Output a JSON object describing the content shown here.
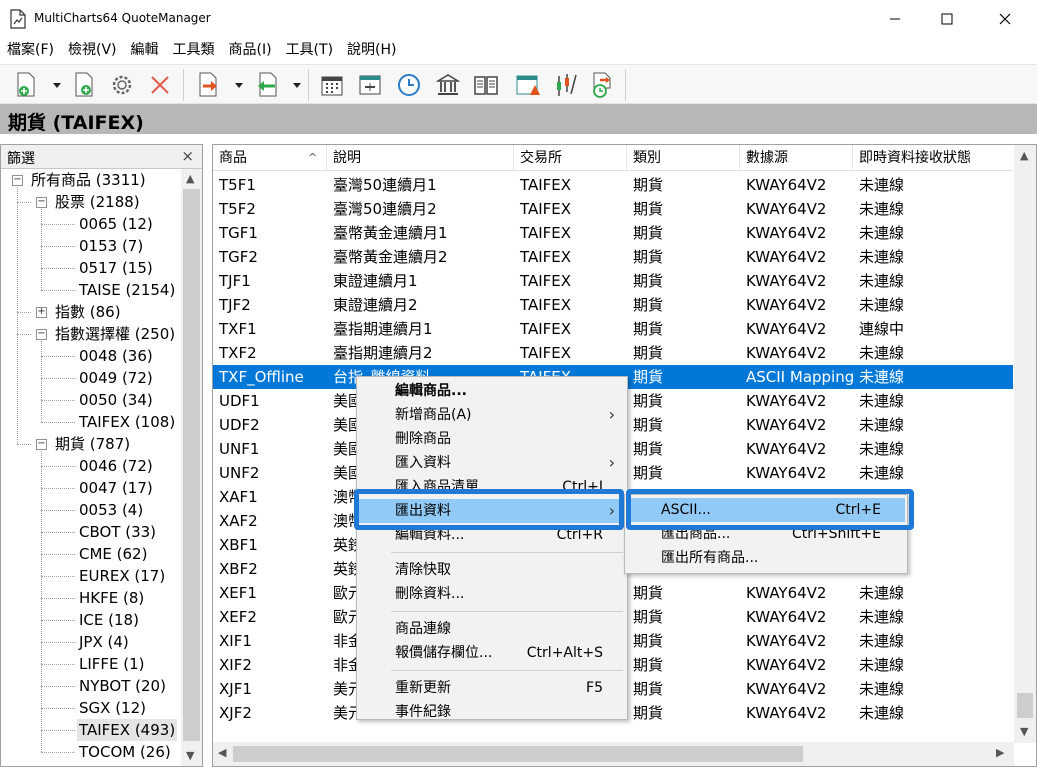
{
  "window": {
    "title": "MultiCharts64 QuoteManager"
  },
  "menubar": [
    "檔案(F)",
    "檢視(V)",
    "編輯",
    "工具類",
    "商品(I)",
    "工具(T)",
    "說明(H)"
  ],
  "toolbar": {
    "icons": [
      "new-symbol-icon",
      "add-symbol-icon",
      "settings-gear-icon",
      "delete-x-icon",
      "export-icon",
      "import-icon",
      "calendar-icon",
      "session-icon",
      "clock-icon",
      "exchange-building-icon",
      "book-icon",
      "calendar-warning-icon",
      "data-edit-icon",
      "scheduler-icon"
    ]
  },
  "header": {
    "title": "期貨 (TAIFEX)"
  },
  "filter": {
    "title": "篩選",
    "close": "×",
    "tree": [
      {
        "label": "所有商品 (3311)",
        "level": 0,
        "toggle": "−"
      },
      {
        "label": "股票 (2188)",
        "level": 1,
        "toggle": "−"
      },
      {
        "label": "0065 (12)",
        "level": 2
      },
      {
        "label": "0153 (7)",
        "level": 2
      },
      {
        "label": "0517 (15)",
        "level": 2
      },
      {
        "label": "TAISE (2154)",
        "level": 2
      },
      {
        "label": "指數 (86)",
        "level": 1,
        "toggle": "+"
      },
      {
        "label": "指數選擇權 (250)",
        "level": 1,
        "toggle": "−"
      },
      {
        "label": "0048 (36)",
        "level": 2
      },
      {
        "label": "0049 (72)",
        "level": 2
      },
      {
        "label": "0050 (34)",
        "level": 2
      },
      {
        "label": "TAIFEX (108)",
        "level": 2
      },
      {
        "label": "期貨 (787)",
        "level": 1,
        "toggle": "−"
      },
      {
        "label": "0046 (72)",
        "level": 2
      },
      {
        "label": "0047 (17)",
        "level": 2
      },
      {
        "label": "0053 (4)",
        "level": 2
      },
      {
        "label": "CBOT (33)",
        "level": 2
      },
      {
        "label": "CME (62)",
        "level": 2
      },
      {
        "label": "EUREX (17)",
        "level": 2
      },
      {
        "label": "HKFE (8)",
        "level": 2
      },
      {
        "label": "ICE (18)",
        "level": 2
      },
      {
        "label": "JPX (4)",
        "level": 2
      },
      {
        "label": "LIFFE (1)",
        "level": 2
      },
      {
        "label": "NYBOT (20)",
        "level": 2
      },
      {
        "label": "SGX (12)",
        "level": 2
      },
      {
        "label": "TAIFEX (493)",
        "level": 2,
        "selected": true
      },
      {
        "label": "TOCOM (26)",
        "level": 2
      }
    ]
  },
  "grid": {
    "columns": [
      "商品",
      "說明",
      "交易所",
      "類別",
      "數據源",
      "即時資料接收狀態"
    ],
    "sort_indicator": "^",
    "rows": [
      [
        "T5F1",
        "臺灣50連續月1",
        "TAIFEX",
        "期貨",
        "KWAY64V2",
        "未連線"
      ],
      [
        "T5F2",
        "臺灣50連續月2",
        "TAIFEX",
        "期貨",
        "KWAY64V2",
        "未連線"
      ],
      [
        "TGF1",
        "臺幣黃金連續月1",
        "TAIFEX",
        "期貨",
        "KWAY64V2",
        "未連線"
      ],
      [
        "TGF2",
        "臺幣黃金連續月2",
        "TAIFEX",
        "期貨",
        "KWAY64V2",
        "未連線"
      ],
      [
        "TJF1",
        "東證連續月1",
        "TAIFEX",
        "期貨",
        "KWAY64V2",
        "未連線"
      ],
      [
        "TJF2",
        "東證連續月2",
        "TAIFEX",
        "期貨",
        "KWAY64V2",
        "未連線"
      ],
      [
        "TXF1",
        "臺指期連續月1",
        "TAIFEX",
        "期貨",
        "KWAY64V2",
        "連線中"
      ],
      [
        "TXF2",
        "臺指期連續月2",
        "TAIFEX",
        "期貨",
        "KWAY64V2",
        "未連線"
      ],
      [
        "TXF_Offline",
        "台指_離線資料",
        "TAIFEX",
        "期貨",
        "ASCII Mapping",
        "未連線"
      ],
      [
        "UDF1",
        "美國",
        "",
        "期貨",
        "KWAY64V2",
        "未連線"
      ],
      [
        "UDF2",
        "美國",
        "",
        "期貨",
        "KWAY64V2",
        "未連線"
      ],
      [
        "UNF1",
        "美國",
        "",
        "期貨",
        "KWAY64V2",
        "未連線"
      ],
      [
        "UNF2",
        "美國",
        "",
        "期貨",
        "KWAY64V2",
        "未連線"
      ],
      [
        "XAF1",
        "澳幣",
        "",
        "",
        "",
        ""
      ],
      [
        "XAF2",
        "澳幣",
        "",
        "",
        "",
        ""
      ],
      [
        "XBF1",
        "英鎊",
        "",
        "",
        "",
        ""
      ],
      [
        "XBF2",
        "英鎊",
        "",
        "",
        "",
        ""
      ],
      [
        "XEF1",
        "歐元",
        "",
        "期貨",
        "KWAY64V2",
        "未連線"
      ],
      [
        "XEF2",
        "歐元",
        "",
        "期貨",
        "KWAY64V2",
        "未連線"
      ],
      [
        "XIF1",
        "非金",
        "",
        "期貨",
        "KWAY64V2",
        "未連線"
      ],
      [
        "XIF2",
        "非金",
        "",
        "期貨",
        "KWAY64V2",
        "未連線"
      ],
      [
        "XJF1",
        "美元",
        "",
        "期貨",
        "KWAY64V2",
        "未連線"
      ],
      [
        "XJF2",
        "美元",
        "",
        "期貨",
        "KWAY64V2",
        "未連線"
      ]
    ],
    "selected_row": 8
  },
  "context_menu": {
    "items": [
      {
        "label": "編輯商品...",
        "bold": true
      },
      {
        "label": "新增商品(A)",
        "submenu": true
      },
      {
        "label": "刪除商品"
      },
      {
        "label": "匯入資料",
        "submenu": true
      },
      {
        "label": "匯入商品清單...",
        "shortcut": "Ctrl+I"
      },
      {
        "label": "匯出資料",
        "submenu": true,
        "highlighted": true
      },
      {
        "label": "編輯資料...",
        "shortcut": "Ctrl+R"
      },
      {
        "separator": true
      },
      {
        "label": "清除快取"
      },
      {
        "label": "刪除資料..."
      },
      {
        "separator": true
      },
      {
        "label": "商品連線"
      },
      {
        "label": "報價儲存欄位...",
        "shortcut": "Ctrl+Alt+S"
      },
      {
        "separator": true
      },
      {
        "label": "重新更新",
        "shortcut": "F5"
      },
      {
        "label": "事件紀錄"
      }
    ]
  },
  "submenu": {
    "items": [
      {
        "label": "ASCII...",
        "shortcut": "Ctrl+E",
        "highlighted": true
      },
      {
        "label": "匯出商品...",
        "shortcut": "Ctrl+Shift+E"
      },
      {
        "label": "匯出所有商品..."
      }
    ]
  },
  "colors": {
    "selection": "#0078d7",
    "menu_highlight": "#91c9f7",
    "focus_ring": "#1e7ad6",
    "header_bar": "#b7b7b7"
  }
}
